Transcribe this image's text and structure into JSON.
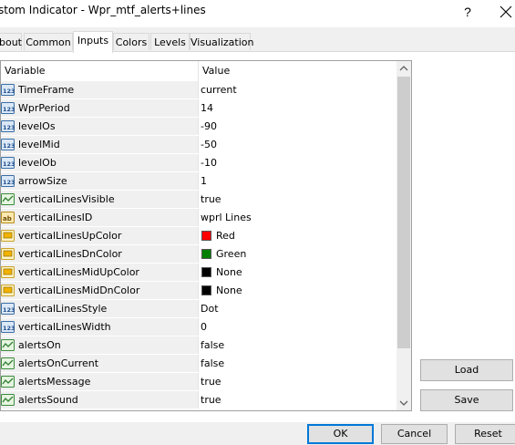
{
  "window": {
    "title": "stom Indicator - Wpr_mtf_alerts+lines",
    "help": "?"
  },
  "tabs": [
    "bout",
    "Common",
    "Inputs",
    "Colors",
    "Levels",
    "Visualization"
  ],
  "grid": {
    "col_variable": "Variable",
    "col_value": "Value",
    "rows": [
      {
        "name": "TimeFrame",
        "value": "current",
        "type": "num"
      },
      {
        "name": "WprPeriod",
        "value": "14",
        "type": "num"
      },
      {
        "name": "levelOs",
        "value": "-90",
        "type": "num"
      },
      {
        "name": "levelMid",
        "value": "-50",
        "type": "num"
      },
      {
        "name": "levelOb",
        "value": "-10",
        "type": "num"
      },
      {
        "name": "arrowSize",
        "value": "1",
        "type": "num"
      },
      {
        "name": "verticalLinesVisible",
        "value": "true",
        "type": "bool"
      },
      {
        "name": "verticalLinesID",
        "value": "wprl Lines",
        "type": "str"
      },
      {
        "name": "verticalLinesUpColor",
        "value": "Red",
        "type": "color",
        "color": "#ff0000"
      },
      {
        "name": "verticalLinesDnColor",
        "value": "Green",
        "type": "color",
        "color": "#008000"
      },
      {
        "name": "verticalLinesMidUpColor",
        "value": "None",
        "type": "color",
        "color": "#000000"
      },
      {
        "name": "verticalLinesMidDnColor",
        "value": "None",
        "type": "color",
        "color": "#000000"
      },
      {
        "name": "verticalLinesStyle",
        "value": "Dot",
        "type": "num"
      },
      {
        "name": "verticalLinesWidth",
        "value": "0",
        "type": "num"
      },
      {
        "name": "alertsOn",
        "value": "false",
        "type": "bool"
      },
      {
        "name": "alertsOnCurrent",
        "value": "false",
        "type": "bool"
      },
      {
        "name": "alertsMessage",
        "value": "true",
        "type": "bool"
      },
      {
        "name": "alertsSound",
        "value": "true",
        "type": "bool"
      }
    ]
  },
  "buttons": {
    "load": "Load",
    "save": "Save",
    "ok": "OK",
    "cancel": "Cancel",
    "reset": "Reset"
  },
  "icons": {
    "num": "numeric-type-icon",
    "bool": "boolean-type-icon",
    "str": "string-type-icon",
    "color": "color-type-icon"
  }
}
